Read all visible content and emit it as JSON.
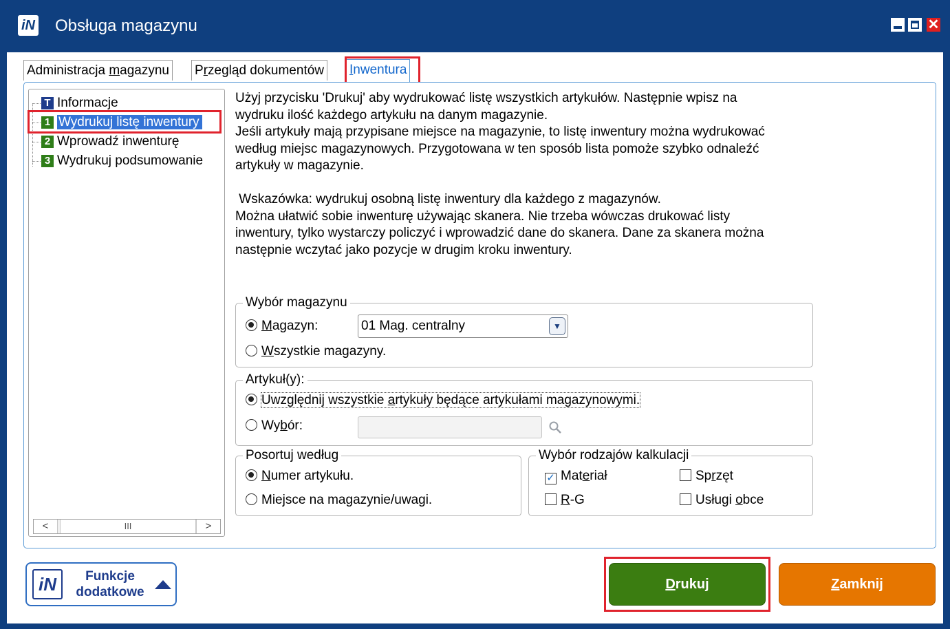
{
  "window": {
    "logo": "iN",
    "title": "Obsługa magazynu",
    "close_glyph": "✕"
  },
  "tabs": [
    {
      "pre": "Administracja ",
      "key": "m",
      "post": "agazynu"
    },
    {
      "pre": "P",
      "key": "r",
      "post": "zegląd dokumentów"
    },
    {
      "pre": "",
      "key": "I",
      "post": "nwentura"
    }
  ],
  "tree": {
    "items": [
      {
        "icon": "T",
        "label": "Informacje"
      },
      {
        "icon": "1",
        "label": "Wydrukuj listę inwentury"
      },
      {
        "icon": "2",
        "label": "Wprowadź inwenturę"
      },
      {
        "icon": "3",
        "label": "Wydrukuj podsumowanie"
      }
    ],
    "scroll_left": "<",
    "scroll_thumb": "III",
    "scroll_right": ">"
  },
  "description": {
    "lines": [
      "Użyj przycisku 'Drukuj' aby wydrukować listę wszystkich artykułów. Następnie wpisz na",
      "wydruku ilość każdego artykułu na danym magazynie.",
      "Jeśli artykuły mają przypisane miejsce na magazynie, to listę inwentury można wydrukować",
      "według miejsc magazynowych. Przygotowana w ten sposób lista pomoże szybko odnaleźć",
      "artykuły w magazynie.",
      "",
      " Wskazówka: wydrukuj osobną listę inwentury dla każdego z magazynów.",
      "Można ułatwić sobie inwenturę używając skanera. Nie trzeba wówczas drukować listy",
      "inwentury, tylko wystarczy policzyć i wprowadzić dane do skanera. Dane za skanera można",
      "następnie wczytać jako pozycje w drugim kroku inwentury."
    ]
  },
  "warehouse_group": {
    "title": "Wybór magazynu",
    "opt_magazyn": {
      "key": "M",
      "post": "agazyn:"
    },
    "combo_value": "01 Mag. centralny",
    "opt_all": {
      "key": "W",
      "post": "szystkie magazyny."
    }
  },
  "articles_group": {
    "title": "Artykuł(y):",
    "opt_all": {
      "pre": "Uwzględnij wszystkie ",
      "key": "a",
      "post": "rtykuły będące artykułami magazynowymi."
    },
    "opt_choice": {
      "pre": "Wy",
      "key": "b",
      "post": "ór:"
    }
  },
  "sort_group": {
    "title": "Posortuj według",
    "opt_number": {
      "key": "N",
      "post": "umer artykułu."
    },
    "opt_place": {
      "pre": "Miejsce na ma",
      "key": "g",
      "post": "azynie/uwagi."
    }
  },
  "calc_group": {
    "title": "Wybór rodzajów kalkulacji",
    "material": {
      "pre": "Mat",
      "key": "e",
      "post": "riał",
      "checked": true
    },
    "equipment": {
      "pre": "Sp",
      "key": "r",
      "post": "zęt",
      "checked": false
    },
    "rg": {
      "pre": "",
      "key": "R",
      "post": "-G",
      "checked": false
    },
    "external": {
      "pre": "Usługi ",
      "key": "o",
      "post": "bce",
      "checked": false
    }
  },
  "buttons": {
    "functions": {
      "line1": "Funkcje",
      "line2": "dodatkowe"
    },
    "print": {
      "key": "D",
      "post": "rukuj"
    },
    "close": {
      "key": "Z",
      "post": "amknij"
    }
  },
  "colors": {
    "titlebar": "#0f3f7f",
    "print_button": "#3b7d11",
    "close_button": "#e67600",
    "highlight": "#e0232d",
    "selection": "#3373d6"
  }
}
